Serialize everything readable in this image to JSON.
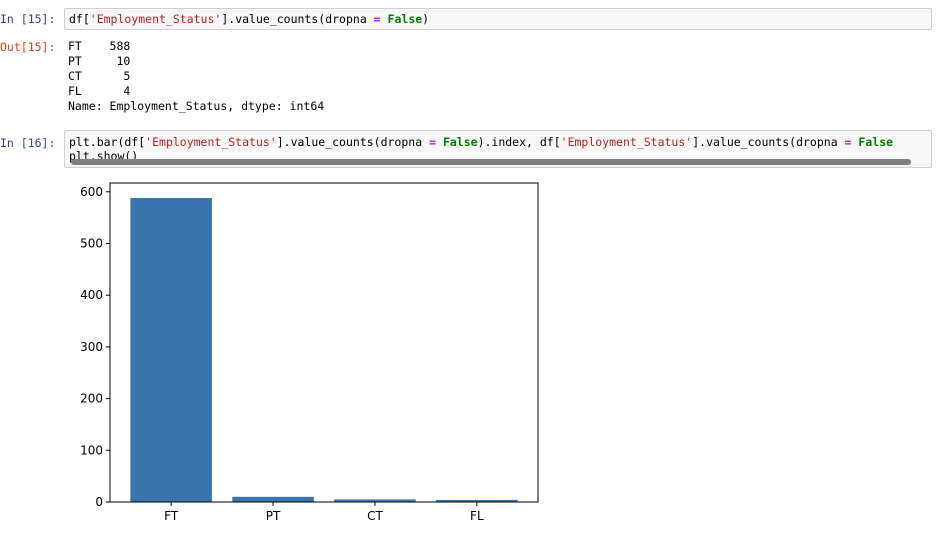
{
  "cell15": {
    "in_prompt": "In [15]:",
    "out_prompt": "Out[15]:",
    "code": {
      "part1": "df[",
      "str1": "'Employment_Status'",
      "part2": "].value_counts(dropna ",
      "op1": "=",
      "sp1": " ",
      "kw1": "False",
      "part3": ")"
    },
    "output_lines": [
      "FT    588",
      "PT     10",
      "CT      5",
      "FL      4",
      "Name: Employment_Status, dtype: int64"
    ]
  },
  "cell16": {
    "in_prompt": "In [16]:",
    "line1": {
      "a": "plt.bar(df[",
      "b": "'Employment_Status'",
      "c": "].value_counts(dropna ",
      "d": "=",
      "e": " ",
      "f": "False",
      "g": ").index, df[",
      "h": "'Employment_Status'",
      "i": "].value_counts(dropna ",
      "j": "=",
      "k": " ",
      "l": "False"
    },
    "line2": "plt.show()"
  },
  "colors": {
    "bar": "#3a75b0",
    "prompt_in": "#303f9f",
    "prompt_out": "#d84315",
    "string": "#ba2121",
    "keyword": "#008000"
  },
  "chart_data": {
    "type": "bar",
    "categories": [
      "FT",
      "PT",
      "CT",
      "FL"
    ],
    "values": [
      588,
      10,
      5,
      4
    ],
    "title": "",
    "xlabel": "",
    "ylabel": "",
    "ylim": [
      0,
      617
    ],
    "yticks": [
      0,
      100,
      200,
      300,
      400,
      500,
      600
    ],
    "ytick_labels": [
      "0",
      "100",
      "200",
      "300",
      "400",
      "500",
      "600"
    ],
    "grid": false
  }
}
